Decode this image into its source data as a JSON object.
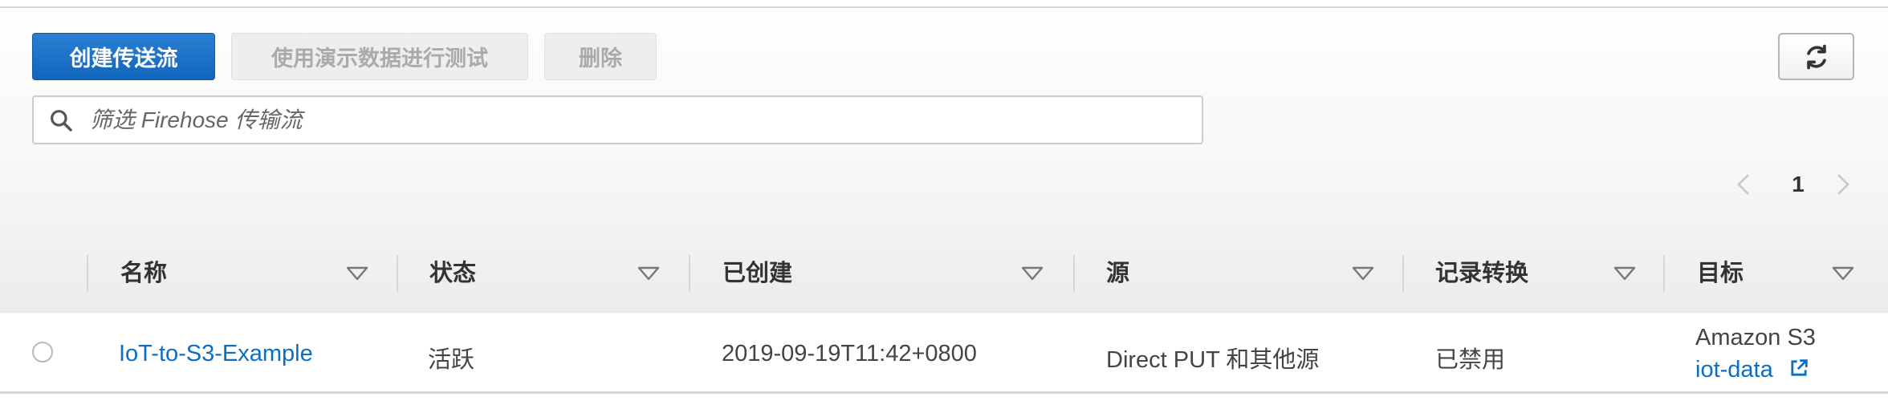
{
  "toolbar": {
    "create_label": "创建传送流",
    "demo_label": "使用演示数据进行测试",
    "delete_label": "删除",
    "refresh_icon": "refresh-icon"
  },
  "search": {
    "placeholder": "筛选 Firehose 传输流",
    "value": "",
    "icon": "search-icon"
  },
  "pagination": {
    "current_page": "1"
  },
  "table": {
    "columns": [
      "名称",
      "状态",
      "已创建",
      "源",
      "记录转换",
      "目标"
    ],
    "rows": [
      {
        "name": "IoT-to-S3-Example",
        "status": "活跃",
        "created": "2019-09-19T11:42+0800",
        "source": "Direct PUT 和其他源",
        "transform": "已禁用",
        "destination_type": "Amazon S3",
        "destination_link": "iot-data"
      }
    ]
  },
  "colors": {
    "primary": "#1166bb",
    "link": "#0b6ec5"
  }
}
